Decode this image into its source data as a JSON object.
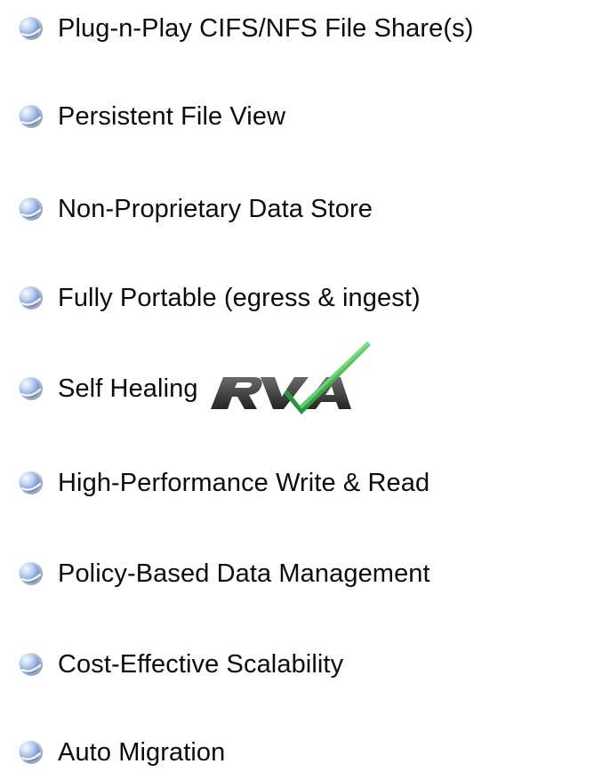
{
  "features": [
    {
      "label": "Plug-n-Play CIFS/NFS File Share(s)",
      "icon": "globe-bullet-icon"
    },
    {
      "label": "Persistent File View",
      "icon": "globe-bullet-icon"
    },
    {
      "label": "Non-Proprietary Data Store",
      "icon": "globe-bullet-icon"
    },
    {
      "label": "Fully Portable (egress & ingest)",
      "icon": "globe-bullet-icon"
    },
    {
      "label": "Self Healing",
      "icon": "globe-bullet-icon",
      "logo": {
        "text": "RVA",
        "icon": "rva-checkmark-logo",
        "colors": {
          "letters": "#3a3a3a",
          "check": "#1f9a3a",
          "check_light": "#5fd067"
        }
      }
    },
    {
      "label": "High-Performance Write & Read",
      "icon": "globe-bullet-icon"
    },
    {
      "label": "Policy-Based Data Management",
      "icon": "globe-bullet-icon"
    },
    {
      "label": "Cost-Effective Scalability",
      "icon": "globe-bullet-icon"
    },
    {
      "label": "Auto Migration",
      "icon": "globe-bullet-icon"
    }
  ],
  "colors": {
    "text": "#0b0b0b",
    "bullet_light": "#eef3fb",
    "bullet_mid": "#a9bfe4",
    "bullet_dark": "#5c7fbf",
    "bullet_ring": "#8a98ae"
  }
}
